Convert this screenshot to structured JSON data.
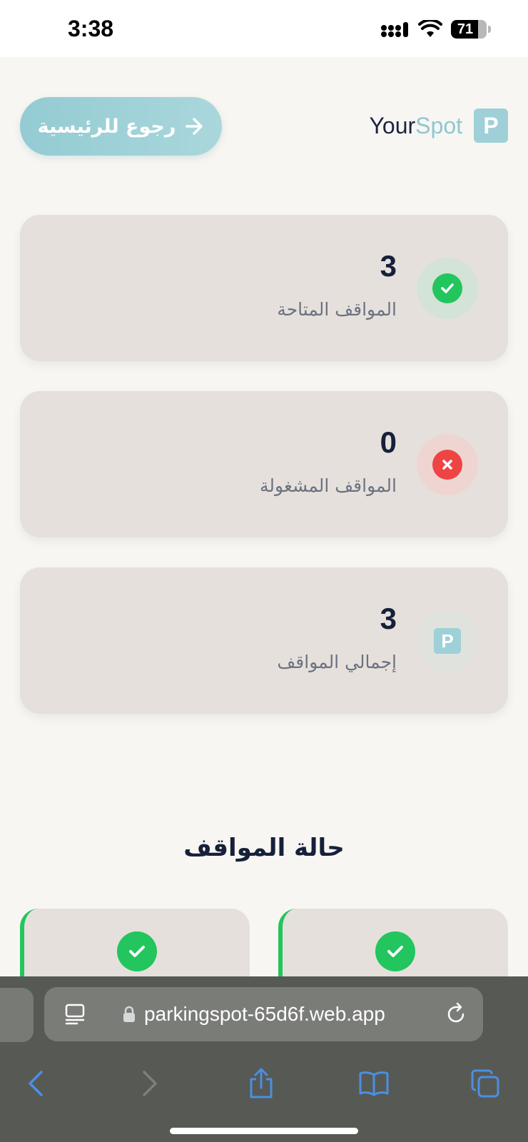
{
  "status_bar": {
    "time": "3:38",
    "battery": "71"
  },
  "header": {
    "back_button": "رجوع للرئيسية",
    "brand_your": "Your",
    "brand_spot": "Spot",
    "brand_logo": "P"
  },
  "stats": [
    {
      "value": "3",
      "label": "المواقف المتاحة",
      "icon": "check-icon",
      "color": "#22c55e"
    },
    {
      "value": "0",
      "label": "المواقف المشغولة",
      "icon": "close-icon",
      "color": "#ef4444"
    },
    {
      "value": "3",
      "label": "إجمالي المواقف",
      "icon": "parking-icon",
      "color": "#9fd0d8"
    }
  ],
  "parking_status": {
    "title": "حالة المواقف",
    "spots": [
      {
        "status": "available",
        "icon": "check-icon"
      },
      {
        "status": "available",
        "icon": "check-icon"
      }
    ]
  },
  "browser": {
    "url": "parkingspot-65d6f.web.app"
  },
  "colors": {
    "accent": "#9fd0d8",
    "available": "#22c55e",
    "occupied": "#ef4444",
    "card_bg": "#e6e0dc",
    "page_bg": "#f8f6f2"
  }
}
